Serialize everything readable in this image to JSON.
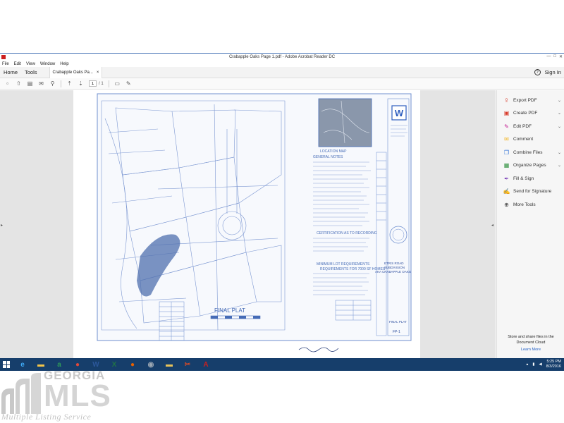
{
  "window": {
    "title": "Crabapple Oaks Page 1.pdf - Adobe Acrobat Reader DC",
    "menu": [
      "File",
      "Edit",
      "View",
      "Window",
      "Help"
    ]
  },
  "tabs": {
    "home": "Home",
    "tools": "Tools",
    "document": "Crabapple Oaks Pa...",
    "close_glyph": "×",
    "help_glyph": "?",
    "sign_in": "Sign In"
  },
  "toolbar": {
    "page_current": "1",
    "page_total": "/ 1"
  },
  "plat": {
    "final_plat": "FINAL PLAT",
    "general_notes": "GENERAL NOTES",
    "location_map": "LOCATION MAP",
    "certification": "CERTIFICATION AS TO RECORDING",
    "minimum_lot": "MINIMUM LOT REQUIREMENTS",
    "requirements": "REQUIREMENTS FOR 7000 SF HOMES",
    "subdivision_1": "ETRIS ROAD",
    "subdivision_2": "SUBDIVISION",
    "subdivision_3": "AKA CRABAPPLE OAKS",
    "final_plat_small": "FINAL PLAT",
    "sheet": "FP-1",
    "logo_letter": "W"
  },
  "tools_pane": {
    "items": [
      {
        "label": "Export PDF",
        "icon": "export-pdf-icon",
        "color": "#d83b2b",
        "chevron": true
      },
      {
        "label": "Create PDF",
        "icon": "create-pdf-icon",
        "color": "#d83b2b",
        "chevron": true
      },
      {
        "label": "Edit PDF",
        "icon": "edit-pdf-icon",
        "color": "#c2188f",
        "chevron": true
      },
      {
        "label": "Comment",
        "icon": "comment-icon",
        "color": "#f2b21a",
        "chevron": false
      },
      {
        "label": "Combine Files",
        "icon": "combine-files-icon",
        "color": "#2c6fd6",
        "chevron": true
      },
      {
        "label": "Organize Pages",
        "icon": "organize-pages-icon",
        "color": "#2c8f3c",
        "chevron": true
      },
      {
        "label": "Fill & Sign",
        "icon": "fill-sign-icon",
        "color": "#7a3fb8",
        "chevron": false
      },
      {
        "label": "Send for Signature",
        "icon": "send-signature-icon",
        "color": "#7a3fb8",
        "chevron": false
      },
      {
        "label": "More Tools",
        "icon": "more-tools-icon",
        "color": "#333333",
        "chevron": false
      }
    ],
    "cloud_line1": "Store and share files in the",
    "cloud_line2": "Document Cloud",
    "learn_more": "Learn More"
  },
  "taskbar": {
    "apps": [
      {
        "icon": "internet-explorer-icon",
        "glyph": "e",
        "color": "#3fa9f5"
      },
      {
        "icon": "file-explorer-icon",
        "glyph": "▬",
        "color": "#f3c44a"
      },
      {
        "icon": "store-icon",
        "glyph": "a",
        "color": "#2e9c5a"
      },
      {
        "icon": "chrome-icon",
        "glyph": "●",
        "color": "#e0483a"
      },
      {
        "icon": "word-icon",
        "glyph": "W",
        "color": "#2b579a"
      },
      {
        "icon": "excel-icon",
        "glyph": "X",
        "color": "#217346"
      },
      {
        "icon": "firefox-icon",
        "glyph": "●",
        "color": "#e66000"
      },
      {
        "icon": "network-icon",
        "glyph": "◉",
        "color": "#9aa6b2"
      },
      {
        "icon": "folder-icon",
        "glyph": "▬",
        "color": "#e8c35a"
      },
      {
        "icon": "snip-icon",
        "glyph": "✂",
        "color": "#d14a2a"
      },
      {
        "icon": "acrobat-icon",
        "glyph": "A",
        "color": "#cc1f1f"
      }
    ],
    "time": "5:25 PM",
    "date": "8/3/2016"
  },
  "watermark": {
    "brand": "GEORGIA",
    "big": "MLS",
    "sub": "Multiple Listing Service"
  }
}
